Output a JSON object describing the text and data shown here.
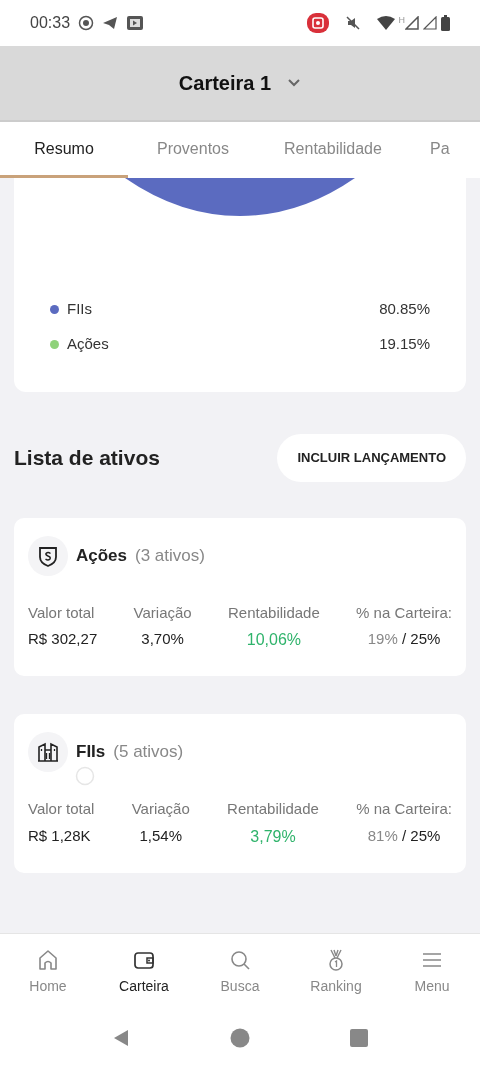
{
  "status_bar": {
    "time": "00:33",
    "network_letter": "H"
  },
  "header": {
    "title": "Carteira 1"
  },
  "tabs": [
    {
      "label": "Resumo",
      "selected": true
    },
    {
      "label": "Proventos",
      "selected": false
    },
    {
      "label": "Rentabilidade",
      "selected": false
    },
    {
      "label": "Pa",
      "selected": false
    }
  ],
  "legend": [
    {
      "label": "FIIs",
      "value": "80.85%",
      "color": "#5b6bc0"
    },
    {
      "label": "Ações",
      "value": "19.15%",
      "color": "#8fd27a"
    }
  ],
  "section": {
    "title": "Lista de ativos",
    "button": "INCLUIR LANÇAMENTO"
  },
  "groups": [
    {
      "kind": "stocks",
      "name": "Ações",
      "count": "(3 ativos)",
      "stats": [
        {
          "label": "Valor total",
          "value": "R$ 302,27",
          "kind": "plain"
        },
        {
          "label": "Variação",
          "value": "3,70%",
          "kind": "plain"
        },
        {
          "label": "Rentabilidade",
          "value": "10,06%",
          "kind": "positive"
        },
        {
          "label": "% na Carteira:",
          "value": "19%",
          "target": "/ 25%",
          "kind": "allocation"
        }
      ]
    },
    {
      "kind": "reits",
      "name": "FIIs",
      "count": "(5 ativos)",
      "stats": [
        {
          "label": "Valor total",
          "value": "R$ 1,28K",
          "kind": "plain"
        },
        {
          "label": "Variação",
          "value": "1,54%",
          "kind": "plain"
        },
        {
          "label": "Rentabilidade",
          "value": "3,79%",
          "kind": "positive"
        },
        {
          "label": "% na Carteira:",
          "value": "81%",
          "target": "/ 25%",
          "kind": "allocation"
        }
      ]
    }
  ],
  "bottom_nav": [
    {
      "label": "Home",
      "kind": "home",
      "selected": false
    },
    {
      "label": "Carteira",
      "kind": "wallet",
      "selected": true
    },
    {
      "label": "Busca",
      "kind": "search",
      "selected": false
    },
    {
      "label": "Ranking",
      "kind": "medal",
      "selected": false
    },
    {
      "label": "Menu",
      "kind": "menu",
      "selected": false
    }
  ]
}
